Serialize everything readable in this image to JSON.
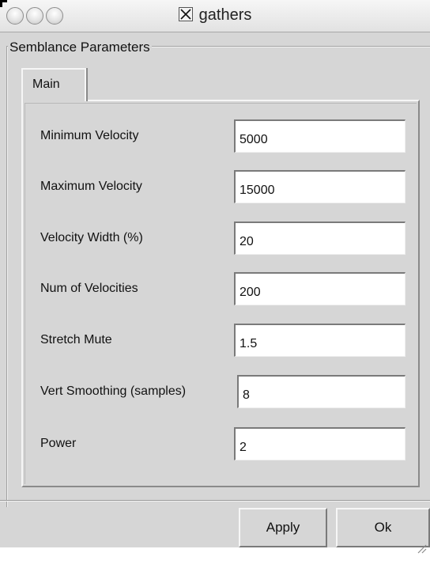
{
  "window": {
    "title": "gathers",
    "title_icon": "x11-icon",
    "controls": [
      "close-icon",
      "minimize-icon",
      "zoom-icon"
    ]
  },
  "group": {
    "label": "Semblance Parameters"
  },
  "tabs": [
    {
      "label": "Main",
      "selected": true
    }
  ],
  "fields": [
    {
      "label": "Minimum Velocity",
      "value": "5000"
    },
    {
      "label": "Maximum Velocity",
      "value": "15000"
    },
    {
      "label": "Velocity Width (%)",
      "value": "20"
    },
    {
      "label": "Num of Velocities",
      "value": "200"
    },
    {
      "label": "Stretch Mute",
      "value": "1.5"
    },
    {
      "label": "Vert Smoothing (samples)",
      "value": "8"
    },
    {
      "label": "Power",
      "value": "2"
    }
  ],
  "buttons": {
    "apply_label": "Apply",
    "ok_label": "Ok"
  },
  "colors": {
    "window_bg": "#d6d6d6",
    "field_bg": "#ffffff"
  }
}
